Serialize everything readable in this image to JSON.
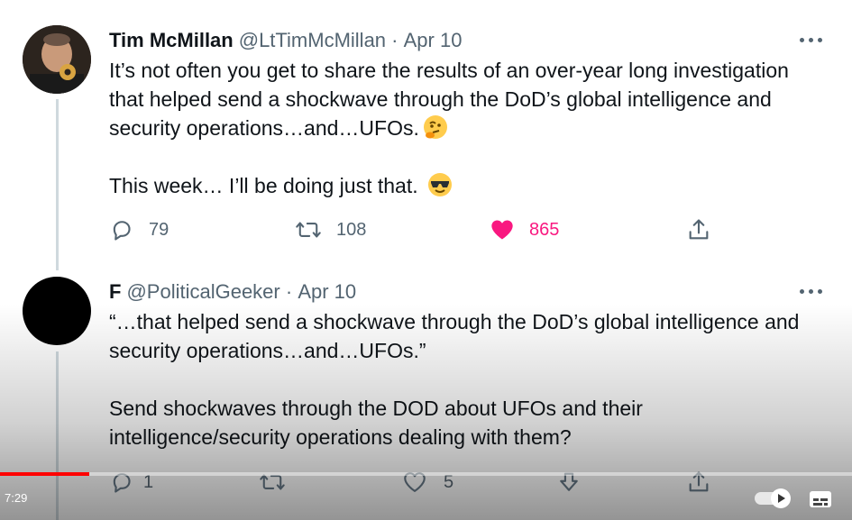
{
  "tweets": [
    {
      "name": "Tim McMillan",
      "handle": "@LtTimMcMillan",
      "sep": " · ",
      "date": "Apr 10",
      "lines": [
        "It’s not often you get to share the results of an over-year long investigation",
        "that helped send a shockwave through the DoD’s global intelligence and",
        "security operations…and…UFOs."
      ],
      "line2": "This week… I’ll be doing just that.",
      "emoji1": "thinking-face-emoji",
      "emoji2": "sunglasses-face-emoji",
      "replies": "79",
      "retweets": "108",
      "likes": "865",
      "liked": true
    },
    {
      "name": "F",
      "handle": "@PoliticalGeeker",
      "sep": " · ",
      "date": "Apr 10",
      "lines": [
        "“…that helped send a shockwave through the DoD’s global intelligence and",
        "security operations…and…UFOs.”"
      ],
      "lines2": [
        "Send shockwaves through the DOD about UFOs and their",
        "intelligence/security operations dealing with them?"
      ],
      "replies": "1",
      "likes": "5"
    }
  ],
  "player": {
    "time": "7:29",
    "progress_fraction": 0.105,
    "progress_color": "#ff0000"
  },
  "colors": {
    "like": "#f91880",
    "muted": "#536471",
    "thread_line": "#cfd9de"
  }
}
